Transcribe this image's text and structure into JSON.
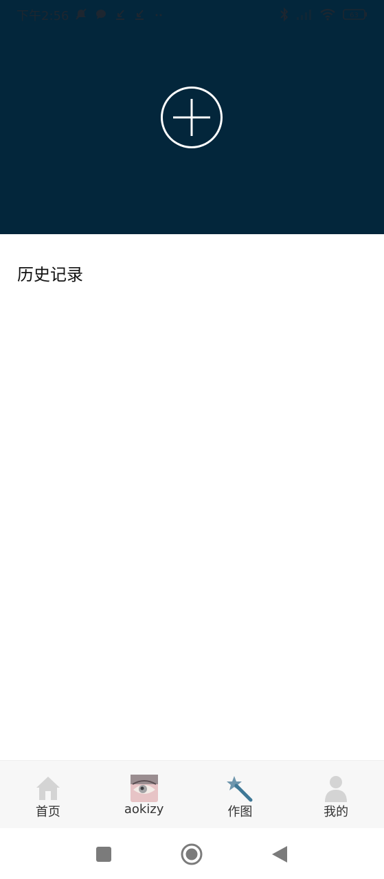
{
  "status_bar": {
    "time": "下午2:56",
    "battery": "63",
    "icons": [
      "mute-icon",
      "message-icon",
      "download-icon",
      "download-icon",
      "more-dots-icon",
      "bluetooth-icon",
      "signal-icon",
      "wifi-icon",
      "battery-icon"
    ]
  },
  "header": {
    "background_color": "#03263b",
    "add_icon": "plus-circle-icon"
  },
  "history": {
    "title": "历史记录",
    "items": []
  },
  "tabbar": {
    "tabs": [
      {
        "label": "首页",
        "icon": "home-icon"
      },
      {
        "label": "aokizy",
        "icon": "avatar-image"
      },
      {
        "label": "作图",
        "icon": "magic-wand-icon",
        "active": true
      },
      {
        "label": "我的",
        "icon": "user-icon"
      }
    ]
  },
  "system_nav": {
    "buttons": [
      "recents-square-icon",
      "home-circle-icon",
      "back-triangle-icon"
    ]
  }
}
